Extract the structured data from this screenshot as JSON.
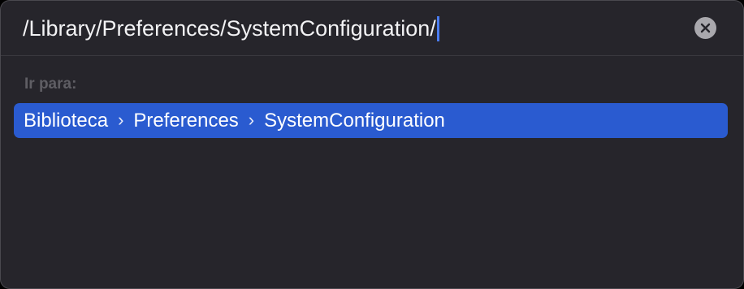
{
  "path_field": {
    "value": "/Library/Preferences/SystemConfiguration/"
  },
  "clear_button": {
    "icon": "clear-icon",
    "glyph": "×"
  },
  "go_to": {
    "label": "Ir para:",
    "result": {
      "segments": [
        "Biblioteca",
        "Preferences",
        "SystemConfiguration"
      ],
      "separator": "›"
    }
  },
  "colors": {
    "panel_background": "#26252b",
    "selection": "#2a5bd0",
    "caret": "#4a7cf0"
  }
}
